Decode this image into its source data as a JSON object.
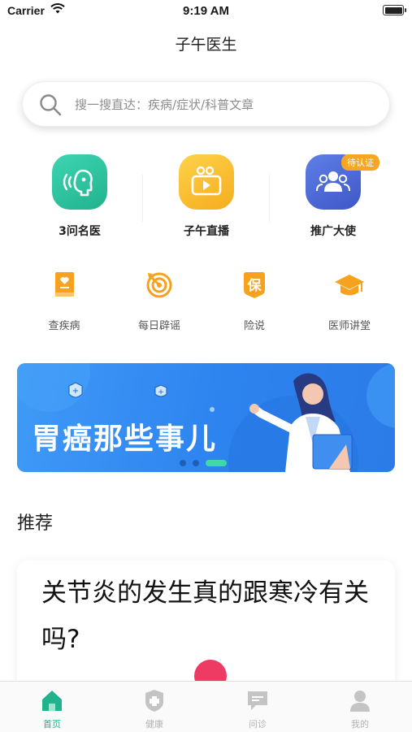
{
  "status_bar": {
    "carrier": "Carrier",
    "time": "9:19 AM"
  },
  "header": {
    "title": "子午医生"
  },
  "search": {
    "placeholder": "搜一搜直达：疾病/症状/科普文章"
  },
  "main_features": [
    {
      "label": "3问名医",
      "icon": "doctor-ask-icon",
      "color": "#2cc5a3"
    },
    {
      "label": "子午直播",
      "icon": "live-video-icon",
      "color": "#f8b92b"
    },
    {
      "label": "推广大使",
      "icon": "group-people-icon",
      "color": "#4a6bd6",
      "badge": "待认证"
    }
  ],
  "sub_features": [
    {
      "label": "查疾病",
      "icon": "book-heart-icon"
    },
    {
      "label": "每日辟谣",
      "icon": "target-icon"
    },
    {
      "label": "险说",
      "icon": "insurance-icon"
    },
    {
      "label": "医师讲堂",
      "icon": "graduation-cap-icon"
    }
  ],
  "banner": {
    "title": "胃癌那些事儿",
    "active_slide": 3,
    "slide_count": 3
  },
  "recommend": {
    "section_title": "推荐",
    "cards": [
      {
        "title": "关节炎的发生真的跟寒冷有关吗?"
      }
    ]
  },
  "tab_bar": {
    "tabs": [
      {
        "label": "首页",
        "icon": "home-icon",
        "active": true
      },
      {
        "label": "健康",
        "icon": "health-shield-icon",
        "active": false
      },
      {
        "label": "问诊",
        "icon": "chat-consult-icon",
        "active": false
      },
      {
        "label": "我的",
        "icon": "user-icon",
        "active": false
      }
    ]
  },
  "colors": {
    "accent": "#21b28e",
    "orange": "#f5a623",
    "banner_blue": "#2d83ef"
  }
}
